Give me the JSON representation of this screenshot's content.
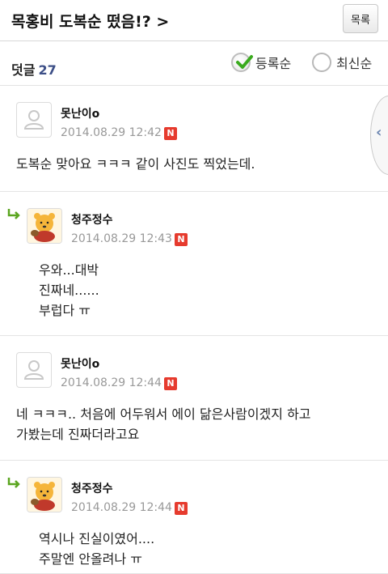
{
  "header": {
    "title": "목홍비 도복순 떴음!? >",
    "list_button": "목록"
  },
  "comments_bar": {
    "label": "덧글",
    "count": "27",
    "sort_options": [
      {
        "label": "등록순",
        "selected": true
      },
      {
        "label": "최신순",
        "selected": false
      }
    ]
  },
  "side_tab": {
    "icon": "chevron-left-icon"
  },
  "comments": [
    {
      "author": "못난이o",
      "date": "2014.08.29 12:42",
      "badge": "N",
      "lines": [
        "도복순 맞아요 ㅋㅋㅋ 같이 사진도 찍었는데."
      ]
    },
    {
      "author": "청주정수",
      "date": "2014.08.29 12:43",
      "badge": "N",
      "lines": [
        "우와...대박",
        "진짜네......",
        "부럽다 ㅠ"
      ]
    },
    {
      "author": "못난이o",
      "date": "2014.08.29 12:44",
      "badge": "N",
      "lines": [
        "네 ㅋㅋㅋ.. 처음에 어두워서 에이 닮은사람이겠지 하고",
        "가봤는데 진짜더라고요"
      ]
    },
    {
      "author": "청주정수",
      "date": "2014.08.29 12:44",
      "badge": "N",
      "lines": [
        "역시나 진실이였어....",
        "주말엔 안올려나 ㅠ"
      ]
    }
  ],
  "colors": {
    "reply_arrow": "#5aa51f",
    "new_badge": "#e63b2e",
    "count": "#3d4f87",
    "check": "#3aaa1e"
  }
}
